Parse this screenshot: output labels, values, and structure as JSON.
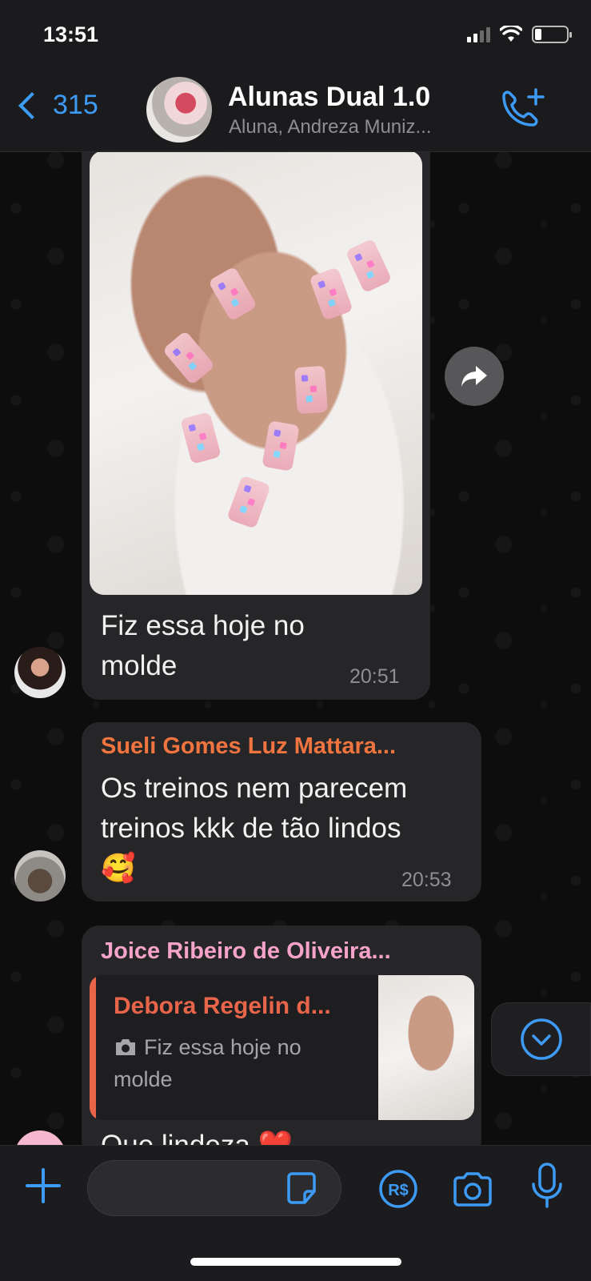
{
  "status_bar": {
    "time": "13:51"
  },
  "header": {
    "back_count": "315",
    "title": "Alunas Dual 1.0",
    "subtitle": "Aluna, Andreza Muniz..."
  },
  "messages": [
    {
      "type": "image",
      "text_line1": "Fiz essa hoje no",
      "text_line2": "molde",
      "time": "20:51"
    },
    {
      "sender": "Sueli Gomes Luz Mattara...",
      "sender_color": "#f0743f",
      "text_line1": "Os treinos nem parecem",
      "text_line2": "treinos kkk de tão lindos",
      "text_line3": "🥰",
      "time": "20:53"
    },
    {
      "sender": "Joice Ribeiro de Oliveira...",
      "sender_color": "#f5a3c9",
      "quote_sender": "Debora Regelin d...",
      "quote_line1": "Fiz essa hoje no",
      "quote_line2": "molde",
      "text_partial": "Que lindeza ❤️"
    }
  ],
  "composer": {
    "placeholder": ""
  },
  "colors": {
    "accent": "#3d9bf5",
    "bubble": "#262628",
    "quote_bar": "#e8654a"
  }
}
